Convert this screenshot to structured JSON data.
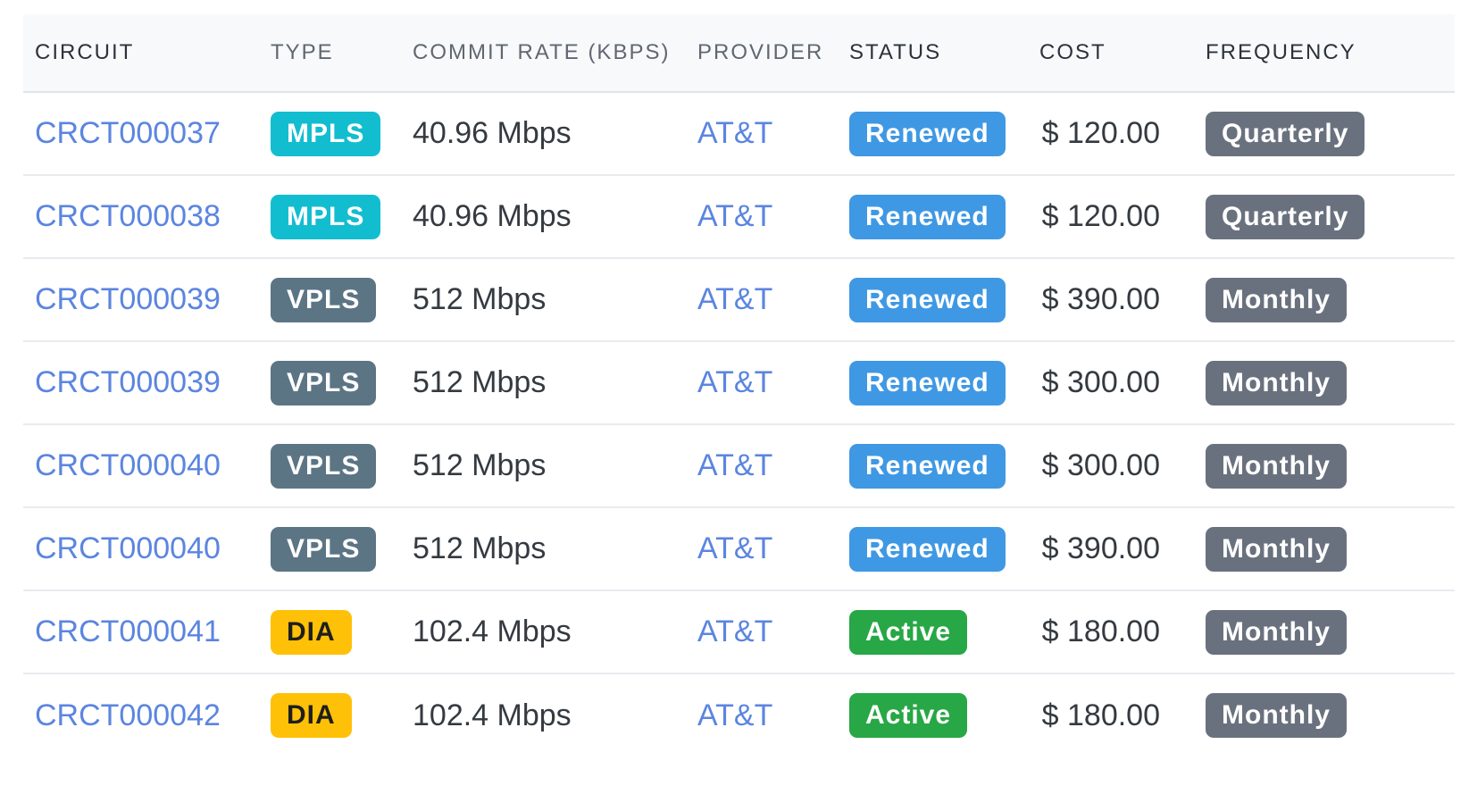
{
  "table": {
    "headers": [
      "CIRCUIT",
      "TYPE",
      "COMMIT RATE (KBPS)",
      "PROVIDER",
      "STATUS",
      "COST",
      "FREQUENCY"
    ],
    "rows": [
      {
        "circuit": "CRCT000037",
        "type": "MPLS",
        "rate": "40.96 Mbps",
        "provider": "AT&T",
        "status": "Renewed",
        "cost": "$ 120.00",
        "frequency": "Quarterly"
      },
      {
        "circuit": "CRCT000038",
        "type": "MPLS",
        "rate": "40.96 Mbps",
        "provider": "AT&T",
        "status": "Renewed",
        "cost": "$ 120.00",
        "frequency": "Quarterly"
      },
      {
        "circuit": "CRCT000039",
        "type": "VPLS",
        "rate": "512 Mbps",
        "provider": "AT&T",
        "status": "Renewed",
        "cost": "$ 390.00",
        "frequency": "Monthly"
      },
      {
        "circuit": "CRCT000039",
        "type": "VPLS",
        "rate": "512 Mbps",
        "provider": "AT&T",
        "status": "Renewed",
        "cost": "$ 300.00",
        "frequency": "Monthly"
      },
      {
        "circuit": "CRCT000040",
        "type": "VPLS",
        "rate": "512 Mbps",
        "provider": "AT&T",
        "status": "Renewed",
        "cost": "$ 300.00",
        "frequency": "Monthly"
      },
      {
        "circuit": "CRCT000040",
        "type": "VPLS",
        "rate": "512 Mbps",
        "provider": "AT&T",
        "status": "Renewed",
        "cost": "$ 390.00",
        "frequency": "Monthly"
      },
      {
        "circuit": "CRCT000041",
        "type": "DIA",
        "rate": "102.4 Mbps",
        "provider": "AT&T",
        "status": "Active",
        "cost": "$ 180.00",
        "frequency": "Monthly"
      },
      {
        "circuit": "CRCT000042",
        "type": "DIA",
        "rate": "102.4 Mbps",
        "provider": "AT&T",
        "status": "Active",
        "cost": "$ 180.00",
        "frequency": "Monthly"
      }
    ]
  },
  "colors": {
    "link": "#5b85e0",
    "mpls": "#12bdd0",
    "vpls": "#5c7585",
    "dia": "#ffc107",
    "renewed": "#3f98e4",
    "active": "#27a745",
    "frequency": "#6a717e"
  }
}
